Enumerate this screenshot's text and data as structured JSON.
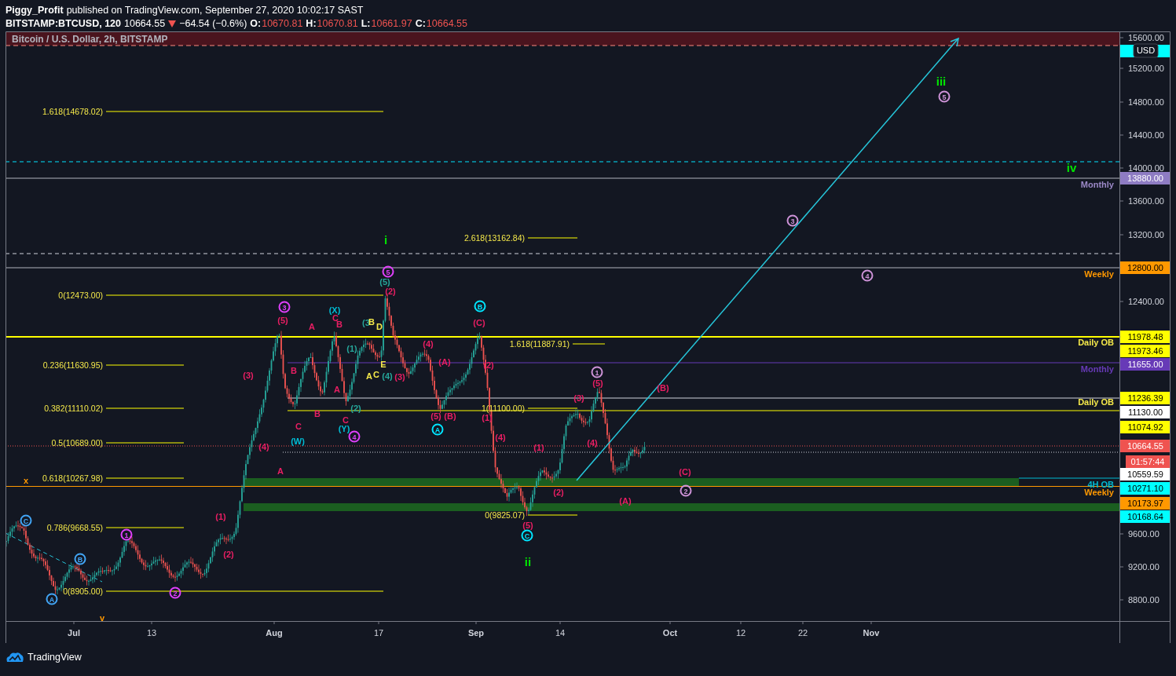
{
  "header": {
    "author": "Piggy_Profit",
    "published": "published on TradingView.com, September 27, 2020 10:02:17 SAST",
    "symbol": "BITSTAMP:BTCUSD, 120",
    "price": "10664.55",
    "change": "−64.54 (−0.6%)",
    "ohlc": [
      {
        "label": "O:",
        "value": "10670.81"
      },
      {
        "label": "H:",
        "value": "10670.81"
      },
      {
        "label": "L:",
        "value": "10661.97"
      },
      {
        "label": "C:",
        "value": "10664.55"
      }
    ]
  },
  "chart": {
    "title": "Bitcoin / U.S. Dollar, 2h, BITSTAMP",
    "currency": "USD",
    "price_ticks": [
      "15600.00",
      "15200.00",
      "14800.00",
      "14400.00",
      "14000.00",
      "13600.00",
      "13200.00",
      "12400.00",
      "9600.00",
      "9200.00",
      "8800.00"
    ],
    "price_tags": [
      {
        "color": "#00ffff"
      },
      {
        "value": "13880.00",
        "color": "#8e7cc3"
      },
      {
        "value": "12800.00",
        "color": "#ff9800"
      },
      {
        "value": "11978.48",
        "color": "#ffff00"
      },
      {
        "value": "11973.46",
        "color": "#ffff00"
      },
      {
        "value": "11655.00",
        "color": "#673ab7"
      },
      {
        "value": "11236.39",
        "color": "#ffff00"
      },
      {
        "value": "11130.00",
        "color": "#ffffff"
      },
      {
        "value": "11074.92",
        "color": "#ffff00"
      },
      {
        "value": "10664.55",
        "color": "#ef5350"
      },
      {
        "value": "01:57:44",
        "color": "#ef5350"
      },
      {
        "value": "10559.59",
        "color": "#ffffff"
      },
      {
        "value": "10271.10",
        "color": "#00ffff"
      },
      {
        "value": "10173.97",
        "color": "#ff9800"
      },
      {
        "value": "10168.64",
        "color": "#00ffff"
      }
    ],
    "level_labels": [
      {
        "text": "Monthly",
        "color": "#9c89c8"
      },
      {
        "text": "Weekly",
        "color": "#ff9800"
      },
      {
        "text": "Daily OB",
        "color": "#f5e94a"
      },
      {
        "text": "Monthly",
        "color": "#673ab7"
      },
      {
        "text": "Daily OB",
        "color": "#f5e94a"
      },
      {
        "text": "4H OB",
        "color": "#00bcd4"
      },
      {
        "text": "Weekly",
        "color": "#ff9800"
      }
    ],
    "fib_labels": [
      "1.618(14678.02)",
      "0(12473.00)",
      "0.236(11630.95)",
      "0.382(11110.02)",
      "0.5(10689.00)",
      "0.618(10267.98)",
      "0.786(9668.55)",
      "0(8905.00)",
      "2.618(13162.84)",
      "1.618(11887.91)",
      "1(11100.00)",
      "0(9825.07)"
    ],
    "wave_labels": [
      {
        "text": "i",
        "color": "#00e600",
        "kind": "plain"
      },
      {
        "text": "ii",
        "color": "#00e600",
        "kind": "plain"
      },
      {
        "text": "iii",
        "color": "#00e600",
        "kind": "plain"
      },
      {
        "text": "iv",
        "color": "#00e600",
        "kind": "plain"
      },
      {
        "text": "5",
        "color": "#ce93d8",
        "kind": "circled"
      },
      {
        "text": "3",
        "color": "#ce93d8",
        "kind": "circled"
      },
      {
        "text": "4",
        "color": "#ce93d8",
        "kind": "circled"
      },
      {
        "text": "1",
        "color": "#ce93d8",
        "kind": "circled"
      },
      {
        "text": "2",
        "color": "#ce93d8",
        "kind": "circled"
      },
      {
        "text": "5",
        "color": "#e040fb",
        "kind": "circled"
      },
      {
        "text": "3",
        "color": "#e040fb",
        "kind": "circled"
      },
      {
        "text": "4",
        "color": "#e040fb",
        "kind": "circled"
      },
      {
        "text": "1",
        "color": "#e040fb",
        "kind": "circled"
      },
      {
        "text": "2",
        "color": "#e040fb",
        "kind": "circled"
      },
      {
        "text": "B",
        "color": "#00e5ff",
        "kind": "circled"
      },
      {
        "text": "A",
        "color": "#00e5ff",
        "kind": "circled"
      },
      {
        "text": "C",
        "color": "#00e5ff",
        "kind": "circled"
      },
      {
        "text": "C",
        "color": "#42a5f5",
        "kind": "circled"
      },
      {
        "text": "B",
        "color": "#42a5f5",
        "kind": "circled"
      },
      {
        "text": "A",
        "color": "#42a5f5",
        "kind": "circled"
      },
      {
        "text": "(5)",
        "color": "#e91e63",
        "kind": "plain"
      },
      {
        "text": "(3)",
        "color": "#e91e63",
        "kind": "plain"
      },
      {
        "text": "(4)",
        "color": "#e91e63",
        "kind": "plain"
      },
      {
        "text": "A",
        "color": "#e91e63",
        "kind": "plain"
      },
      {
        "text": "(1)",
        "color": "#e91e63",
        "kind": "plain"
      },
      {
        "text": "(2)",
        "color": "#e91e63",
        "kind": "plain"
      },
      {
        "text": "A",
        "color": "#e91e63",
        "kind": "plain"
      },
      {
        "text": "C",
        "color": "#e91e63",
        "kind": "plain"
      },
      {
        "text": "B",
        "color": "#e91e63",
        "kind": "plain"
      },
      {
        "text": "B",
        "color": "#e91e63",
        "kind": "plain"
      },
      {
        "text": "C",
        "color": "#e91e63",
        "kind": "plain"
      },
      {
        "text": "B",
        "color": "#e91e63",
        "kind": "plain"
      },
      {
        "text": "A",
        "color": "#e91e63",
        "kind": "plain"
      },
      {
        "text": "C",
        "color": "#e91e63",
        "kind": "plain"
      },
      {
        "text": "(2)",
        "color": "#e91e63",
        "kind": "plain"
      },
      {
        "text": "(3)",
        "color": "#e91e63",
        "kind": "plain"
      },
      {
        "text": "(4)",
        "color": "#e91e63",
        "kind": "plain"
      },
      {
        "text": "(A)",
        "color": "#e91e63",
        "kind": "plain"
      },
      {
        "text": "(5)",
        "color": "#e91e63",
        "kind": "plain"
      },
      {
        "text": "(B)",
        "color": "#e91e63",
        "kind": "plain"
      },
      {
        "text": "(C)",
        "color": "#e91e63",
        "kind": "plain"
      },
      {
        "text": "(2)",
        "color": "#e91e63",
        "kind": "plain"
      },
      {
        "text": "(1)",
        "color": "#e91e63",
        "kind": "plain"
      },
      {
        "text": "(4)",
        "color": "#e91e63",
        "kind": "plain"
      },
      {
        "text": "(5)",
        "color": "#e91e63",
        "kind": "plain"
      },
      {
        "text": "(1)",
        "color": "#e91e63",
        "kind": "plain"
      },
      {
        "text": "(2)",
        "color": "#e91e63",
        "kind": "plain"
      },
      {
        "text": "(3)",
        "color": "#e91e63",
        "kind": "plain"
      },
      {
        "text": "(5)",
        "color": "#e91e63",
        "kind": "plain"
      },
      {
        "text": "(4)",
        "color": "#e91e63",
        "kind": "plain"
      },
      {
        "text": "(B)",
        "color": "#e91e63",
        "kind": "plain"
      },
      {
        "text": "(C)",
        "color": "#e91e63",
        "kind": "plain"
      },
      {
        "text": "(A)",
        "color": "#e91e63",
        "kind": "plain"
      },
      {
        "text": "(5)",
        "color": "#26a69a",
        "kind": "plain"
      },
      {
        "text": "(3",
        "color": "#26a69a",
        "kind": "plain"
      },
      {
        "text": "(1)",
        "color": "#26a69a",
        "kind": "plain"
      },
      {
        "text": "(4)",
        "color": "#26a69a",
        "kind": "plain"
      },
      {
        "text": "(2)",
        "color": "#26a69a",
        "kind": "plain"
      },
      {
        "text": "(X)",
        "color": "#00bcd4",
        "kind": "plain"
      },
      {
        "text": "(Y)",
        "color": "#00bcd4",
        "kind": "plain"
      },
      {
        "text": "(W)",
        "color": "#00bcd4",
        "kind": "plain"
      },
      {
        "text": "B",
        "color": "#f5e94a",
        "kind": "plain"
      },
      {
        "text": "D",
        "color": "#f5e94a",
        "kind": "plain"
      },
      {
        "text": "E",
        "color": "#f5e94a",
        "kind": "plain"
      },
      {
        "text": "A",
        "color": "#f5e94a",
        "kind": "plain"
      },
      {
        "text": "C",
        "color": "#f5e94a",
        "kind": "plain"
      },
      {
        "text": "x",
        "color": "#ff9800",
        "kind": "plain"
      },
      {
        "text": "v",
        "color": "#ff9800",
        "kind": "plain"
      }
    ],
    "time_labels": [
      {
        "label": "Jul",
        "kind": "month"
      },
      {
        "label": "13",
        "kind": "day"
      },
      {
        "label": "Aug",
        "kind": "month"
      },
      {
        "label": "17",
        "kind": "day"
      },
      {
        "label": "Sep",
        "kind": "month"
      },
      {
        "label": "14",
        "kind": "day"
      },
      {
        "label": "Oct",
        "kind": "month"
      },
      {
        "label": "12",
        "kind": "day"
      },
      {
        "label": "22",
        "kind": "day"
      },
      {
        "label": "Nov",
        "kind": "month"
      }
    ]
  },
  "footer": {
    "brand": "TradingView"
  }
}
